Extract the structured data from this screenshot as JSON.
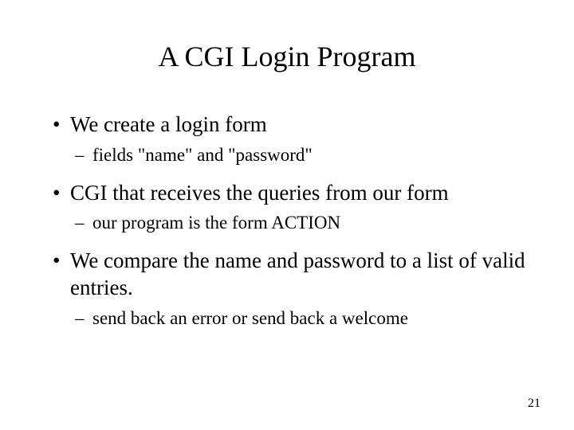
{
  "title": "A CGI Login Program",
  "bullets": [
    {
      "text": "We create a login form",
      "sub": "fields \"name\" and \"password\""
    },
    {
      "text": "CGI that receives the queries from our form",
      "sub": "our program is the form ACTION"
    },
    {
      "text": "We compare the name and password to a list of valid entries.",
      "sub": "send back an error or send back a welcome"
    }
  ],
  "pageNumber": "21"
}
